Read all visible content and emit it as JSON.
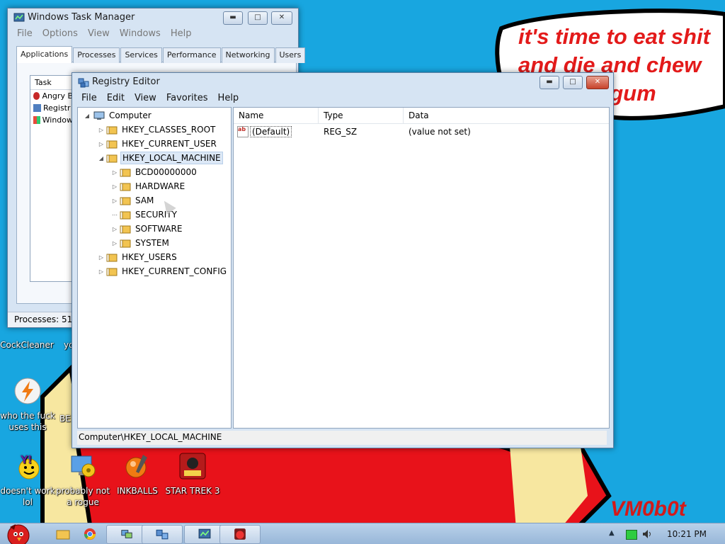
{
  "desktop": {
    "speech_text": "it's time to eat shit\nand die and chew\n               gum",
    "watermark": "VM0b0t",
    "icons": [
      {
        "label": "CockCleaner"
      },
      {
        "label": "yo"
      },
      {
        "label": "who the fuck uses this"
      },
      {
        "label": "BE"
      },
      {
        "label": "doesn't work lol"
      },
      {
        "label": "probably not a rogue"
      },
      {
        "label": "INKBALLS"
      },
      {
        "label": "STAR TREK 3"
      }
    ]
  },
  "task_manager": {
    "title": "Windows Task Manager",
    "menu": [
      "File",
      "Options",
      "View",
      "Windows",
      "Help"
    ],
    "tabs": [
      "Applications",
      "Processes",
      "Services",
      "Performance",
      "Networking",
      "Users"
    ],
    "active_tab": "Applications",
    "column_task": "Task",
    "tasks": [
      "Angry B",
      "Registr",
      "Window"
    ],
    "status": "Processes: 51"
  },
  "regedit": {
    "title": "Registry Editor",
    "menu": [
      "File",
      "Edit",
      "View",
      "Favorites",
      "Help"
    ],
    "tree": {
      "root": "Computer",
      "hives": [
        "HKEY_CLASSES_ROOT",
        "HKEY_CURRENT_USER",
        "HKEY_LOCAL_MACHINE"
      ],
      "hklm_children": [
        "BCD00000000",
        "HARDWARE",
        "SAM",
        "SECURITY",
        "SOFTWARE",
        "SYSTEM"
      ],
      "more_hives": [
        "HKEY_USERS",
        "HKEY_CURRENT_CONFIG"
      ]
    },
    "columns": {
      "name": "Name",
      "type": "Type",
      "data": "Data"
    },
    "values": [
      {
        "name": "(Default)",
        "type": "REG_SZ",
        "data": "(value not set)"
      }
    ],
    "status_path": "Computer\\HKEY_LOCAL_MACHINE"
  },
  "taskbar": {
    "clock": "10:21 PM"
  },
  "colors": {
    "desktop": "#18a6e0",
    "speech_text": "#e31a1a",
    "selection": "#dce8f6"
  }
}
